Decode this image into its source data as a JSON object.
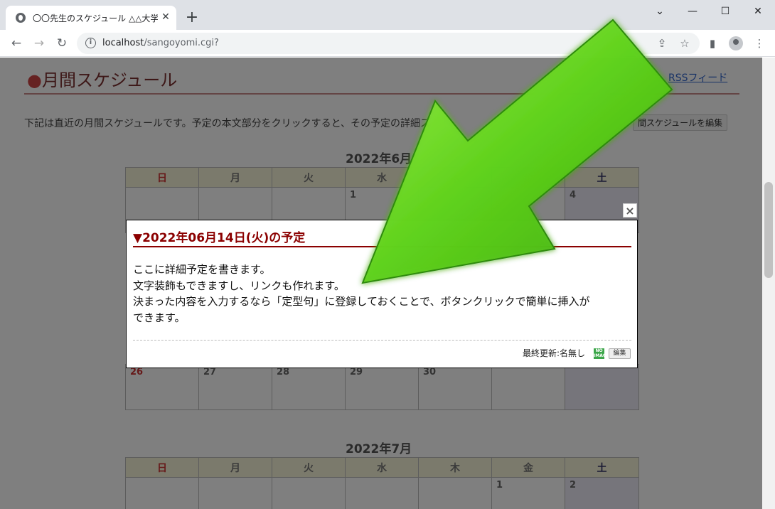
{
  "browser": {
    "tab_title": "〇〇先生のスケジュール △△大学☆",
    "tab_close": "✕",
    "new_tab": "+",
    "window_controls": {
      "tab_search": "⌄",
      "minimize": "—",
      "maximize": "☐",
      "close": "✕"
    },
    "url_host": "localhost",
    "url_path": "/sangoyomi.cgi?",
    "icons": [
      "back-icon",
      "forward-icon",
      "reload-icon",
      "info-icon",
      "share-icon",
      "star-icon",
      "side-panel-icon",
      "profile-icon",
      "menu-icon"
    ]
  },
  "page": {
    "section_title_dot": "●",
    "section_title": "月間スケジュール",
    "rss_link": "RSSフィード",
    "intro": "下記は直近の月間スケジュールです。予定の本文部分をクリックすると、その予定の詳細ス",
    "edit_month_button": "間スケジュールを編集",
    "weekdays": [
      "日",
      "月",
      "火",
      "水",
      "木",
      "金",
      "土"
    ],
    "calendars": [
      {
        "title": "2022年6月"
      },
      {
        "title": "2022年7月"
      }
    ],
    "june_first_row": [
      "",
      "",
      "",
      "1",
      "",
      "",
      "4"
    ],
    "june_last_row": [
      "26",
      "27",
      "28",
      "29",
      "30",
      "",
      ""
    ],
    "july_first_row": [
      "",
      "",
      "",
      "",
      "",
      "1",
      "2"
    ]
  },
  "popup": {
    "close": "×",
    "title": "▼2022年06月14日(火)の予定",
    "body_lines": [
      "ここに詳細予定を書きます。",
      "文字装飾もできますし、リンクも作れます。",
      "決まった内容を入力するなら「定型句」に登録しておくことで、ボタンクリックで簡単に挿入が",
      "できます。"
    ],
    "updated": "最終更新:名無し",
    "no_image_icon": "NO IMAGE",
    "edit_button": "編集"
  },
  "colors": {
    "accent": "#8b0000",
    "arrow_green": "#5ed11a",
    "saturday_bg": "#eceaf7",
    "weekday_header_bg": "#f7f4d8"
  }
}
